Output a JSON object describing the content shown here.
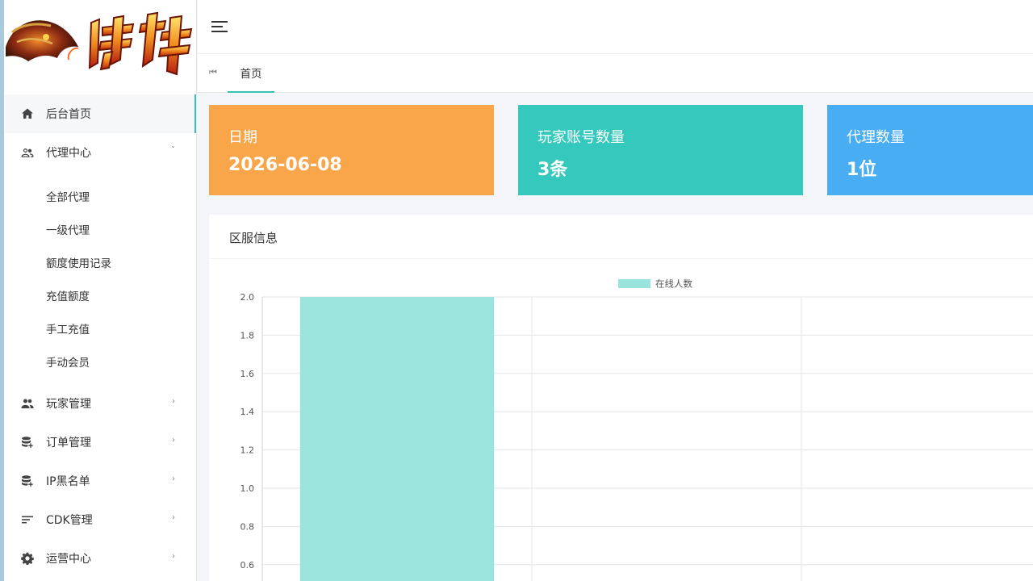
{
  "logo": {
    "text": "封神"
  },
  "sidebar": {
    "items": [
      {
        "label": "后台首页",
        "icon": "home-icon",
        "active": true
      },
      {
        "label": "代理中心",
        "icon": "users-outline-icon",
        "expanded": true,
        "children": [
          "全部代理",
          "一级代理",
          "额度使用记录",
          "充值额度",
          "手工充值",
          "手动会员"
        ]
      },
      {
        "label": "玩家管理",
        "icon": "group-icon"
      },
      {
        "label": "订单管理",
        "icon": "database-plus-icon"
      },
      {
        "label": "IP黑名单",
        "icon": "database-plus-icon"
      },
      {
        "label": "CDK管理",
        "icon": "sort-lines-icon"
      },
      {
        "label": "运营中心",
        "icon": "gear-icon"
      }
    ]
  },
  "tabs": {
    "home": "首页"
  },
  "stats": [
    {
      "label": "日期",
      "value": "2026-06-08",
      "color": "#f9a54a"
    },
    {
      "label": "玩家账号数量",
      "value": "3条",
      "color": "#35c9bd"
    },
    {
      "label": "代理数量",
      "value": "1位",
      "color": "#48adf2"
    }
  ],
  "panel": {
    "title": "区服信息"
  },
  "chart_data": {
    "type": "bar",
    "categories": [
      "",
      "",
      ""
    ],
    "series": [
      {
        "name": "在线人数",
        "values": [
          2,
          0,
          0
        ],
        "color": "#9be3dd"
      }
    ],
    "ylim": [
      0,
      2
    ],
    "yticks": [
      "2.0",
      "1.8",
      "1.6",
      "1.4",
      "1.2",
      "1.0",
      "0.8",
      "0.6"
    ],
    "legend": "top-center",
    "grid": true
  }
}
